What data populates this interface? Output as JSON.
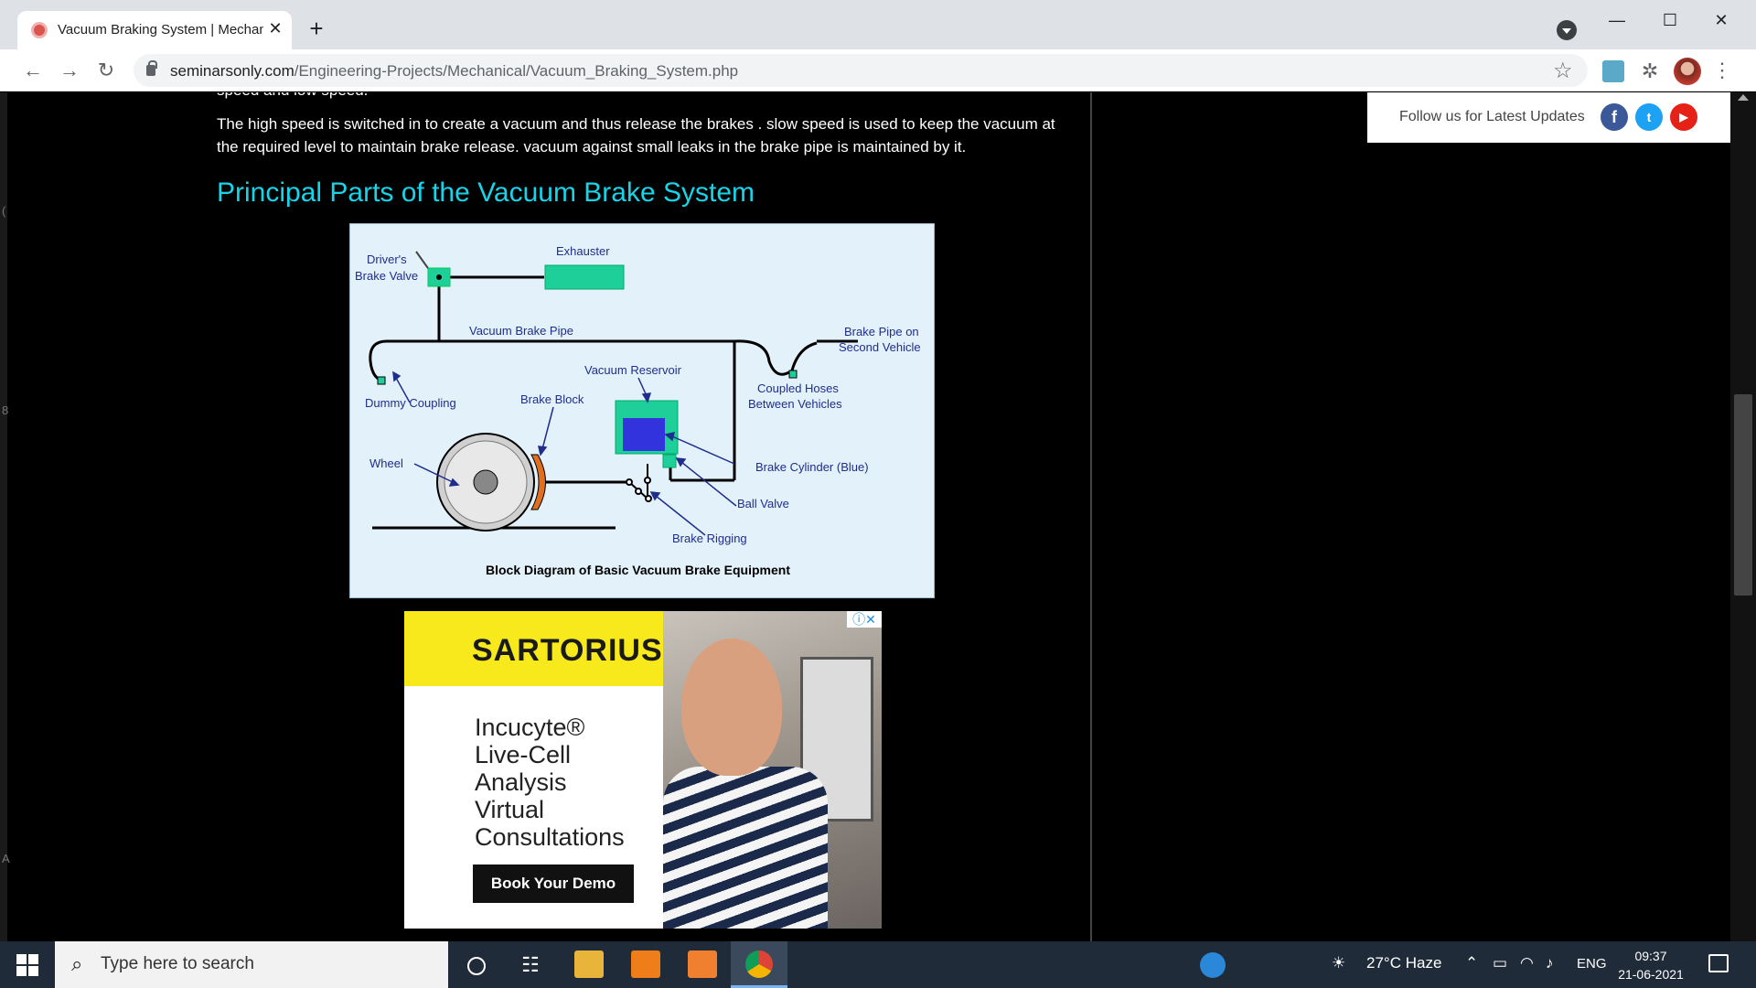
{
  "browser": {
    "tab_title": "Vacuum Braking System | Mechanical",
    "tab_close": "✕",
    "new_tab": "+",
    "url_host": "seminarsonly.com",
    "url_path": "/Engineering-Projects/Mechanical/Vacuum_Braking_System.php",
    "icons": [
      "back-arrow-icon",
      "forward-arrow-icon",
      "reload-icon",
      "lock-icon",
      "star-icon",
      "extensions-icon",
      "menu-icon"
    ]
  },
  "article": {
    "cut_line": "speed and low speed.",
    "paragraph": "The high speed is switched in to create a vacuum and thus release the brakes . slow speed is used to keep the vacuum at the required level to maintain brake release. vacuum against small leaks in the brake pipe is maintained by it.",
    "heading": "Principal Parts of the Vacuum Brake System"
  },
  "diagram": {
    "labels": {
      "drivers_valve_1": "Driver's",
      "drivers_valve_2": "Brake Valve",
      "exhauster": "Exhauster",
      "vacuum_brake_pipe": "Vacuum Brake Pipe",
      "brake_pipe_second_1": "Brake Pipe on",
      "brake_pipe_second_2": "Second Vehicle",
      "vacuum_reservoir": "Vacuum Reservoir",
      "coupled_hoses_1": "Coupled Hoses",
      "coupled_hoses_2": "Between Vehicles",
      "dummy_coupling": "Dummy Coupling",
      "brake_block": "Brake Block",
      "wheel": "Wheel",
      "brake_cylinder": "Brake Cylinder (Blue)",
      "ball_valve": "Ball Valve",
      "brake_rigging": "Brake Rigging"
    },
    "caption": "Block Diagram of Basic Vacuum Brake Equipment",
    "colors": {
      "component": "#1fcf9a",
      "cylinder": "#3333dd",
      "brake_block": "#e07020",
      "label": "#1f2d8c"
    }
  },
  "follow": {
    "text": "Follow us for Latest Updates",
    "facebook": "f",
    "twitter": "t",
    "youtube": "▶"
  },
  "ad": {
    "brand": "SARTORIUS",
    "line1": "Incucyte®",
    "line2": "Live-Cell",
    "line3": "Analysis",
    "line4": "Virtual",
    "line5": "Consultations",
    "cta": "Book Your Demo",
    "choices": "ⓘ✕"
  },
  "taskbar": {
    "search_placeholder": "Type here to search",
    "weather": "27°C  Haze",
    "language": "ENG",
    "time": "09:37",
    "date": "21-06-2021"
  },
  "edge_chars": [
    "(",
    "8",
    "A"
  ]
}
